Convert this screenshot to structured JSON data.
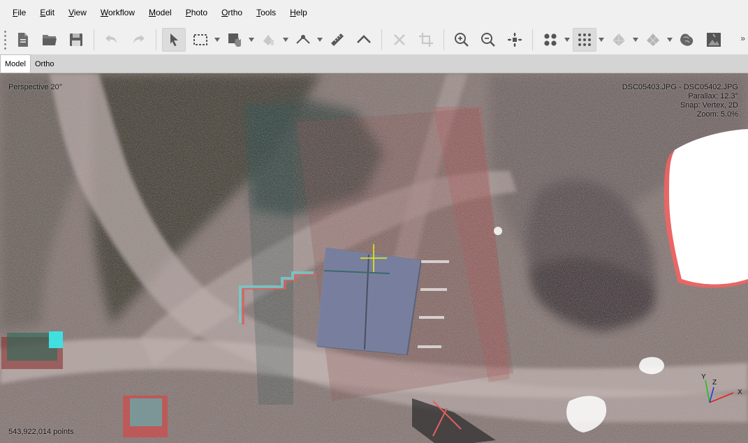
{
  "menu": {
    "items": [
      {
        "label": "File",
        "ul": "F",
        "rest": "ile"
      },
      {
        "label": "Edit",
        "ul": "E",
        "rest": "dit"
      },
      {
        "label": "View",
        "ul": "V",
        "rest": "iew"
      },
      {
        "label": "Workflow",
        "ul": "W",
        "rest": "orkflow"
      },
      {
        "label": "Model",
        "ul": "M",
        "rest": "odel"
      },
      {
        "label": "Photo",
        "ul": "P",
        "rest": "hoto"
      },
      {
        "label": "Ortho",
        "ul": "O",
        "rest": "rtho"
      },
      {
        "label": "Tools",
        "ul": "T",
        "rest": "ools"
      },
      {
        "label": "Help",
        "ul": "H",
        "rest": "elp"
      }
    ]
  },
  "toolbar": {
    "icons": [
      "new-icon",
      "open-icon",
      "save-icon",
      "undo-icon",
      "redo-icon",
      "navigation-icon",
      "rectangle-selection-icon",
      "draw-polygon-icon",
      "paint-icon",
      "ruler-icon",
      "line-icon",
      "delete-icon",
      "crop-icon",
      "zoom-in-icon",
      "zoom-out-icon",
      "reset-view-icon",
      "point-cloud-icon",
      "dense-cloud-icon",
      "mesh-icon",
      "tiled-model-icon",
      "dem-icon",
      "ortho-icon"
    ],
    "more": "»"
  },
  "tabs": [
    {
      "label": "Model",
      "active": true
    },
    {
      "label": "Ortho",
      "active": false
    }
  ],
  "viewport": {
    "projection": "Perspective 20°",
    "stereo_pair": "DSC05403.JPG - DSC05402.JPG",
    "parallax": "Parallax: 12.3°",
    "snap": "Snap: Vertex, 2D",
    "zoom": "Zoom: 5.0%",
    "point_count": "543,922,014 points",
    "axis_x_label": "X",
    "axis_y_label": "Y",
    "axis_z_label": "Z"
  },
  "colors": {
    "accent_red": "#e04040",
    "accent_cyan": "#30c8c8",
    "axis_x": "#e02020",
    "axis_y": "#20c020",
    "axis_z": "#2040e0",
    "crosshair": "#f0f000"
  }
}
